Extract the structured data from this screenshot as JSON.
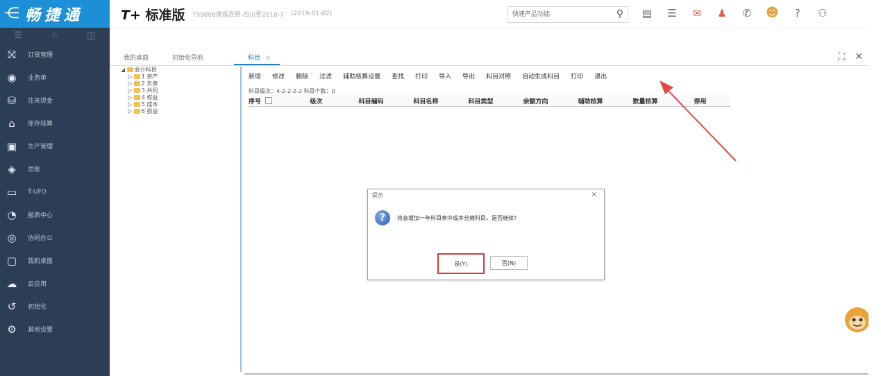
{
  "brand": {
    "back_icon": "back-arrow-icon",
    "logo_text": "畅捷通"
  },
  "topbar": {
    "edition": "标准版",
    "edition_prefix": "T+",
    "company": "799888德昌百贸-四川至2018-7",
    "date": "(2019-01-02)",
    "search_placeholder": "快速产品功能",
    "icons": [
      "search-icon",
      "calendar-icon",
      "list-icon",
      "notification-icon",
      "alert-icon",
      "phone-icon",
      "mascot-icon",
      "help-icon",
      "user-icon"
    ]
  },
  "sidebar": {
    "top_icons": [
      "menu-icon",
      "star-icon",
      "recent-icon"
    ],
    "items": [
      {
        "label": "订货管理",
        "icon": "order-icon"
      },
      {
        "label": "业务单",
        "icon": "business-icon"
      },
      {
        "label": "往来现金",
        "icon": "cash-icon"
      },
      {
        "label": "库存核算",
        "icon": "warehouse-icon"
      },
      {
        "label": "生产管理",
        "icon": "production-icon"
      },
      {
        "label": "总账",
        "icon": "ledger-icon"
      },
      {
        "label": "T-UFO",
        "icon": "ufo-icon"
      },
      {
        "label": "报表中心",
        "icon": "report-icon"
      },
      {
        "label": "协同办公",
        "icon": "collab-icon"
      },
      {
        "label": "我的桌面",
        "icon": "desktop-icon"
      },
      {
        "label": "云应用",
        "icon": "cloud-icon"
      },
      {
        "label": "初始化",
        "icon": "init-icon"
      },
      {
        "label": "其他设置",
        "icon": "settings-icon"
      }
    ]
  },
  "tabs": {
    "items": [
      "我的桌面",
      "初始化导航"
    ],
    "active": "科目",
    "active_close": "×",
    "window_icons": [
      "restore-icon",
      "close-icon"
    ]
  },
  "tree": {
    "root": "会计科目",
    "children": [
      "1 资产",
      "2 负债",
      "3 共同",
      "4 权益",
      "5 成本",
      "6 损益"
    ]
  },
  "toolbar": {
    "items": [
      "新增",
      "修改",
      "删除",
      "过滤",
      "辅助核算设置",
      "查找",
      "打印",
      "导入",
      "导出",
      "科目对照",
      "自动生成科目",
      "打印",
      "退出"
    ]
  },
  "levels_text": "科目级次：4-2-2-2-2  科目个数：0",
  "grid": {
    "columns": [
      "序号",
      "级次",
      "科目编码",
      "科目名称",
      "科目类型",
      "余额方向",
      "辅助核算",
      "数量核算",
      "停用"
    ]
  },
  "dialog": {
    "title": "提示",
    "message": "将会增加一年科目表中成本分摊科目，是否继续?",
    "yes_label": "是(Y)",
    "no_label": "否(N)",
    "close": "×"
  },
  "colors": {
    "brand_blue": "#1d8fd6",
    "sidebar": "#2c3e55",
    "highlight_red": "#d23b3b"
  }
}
